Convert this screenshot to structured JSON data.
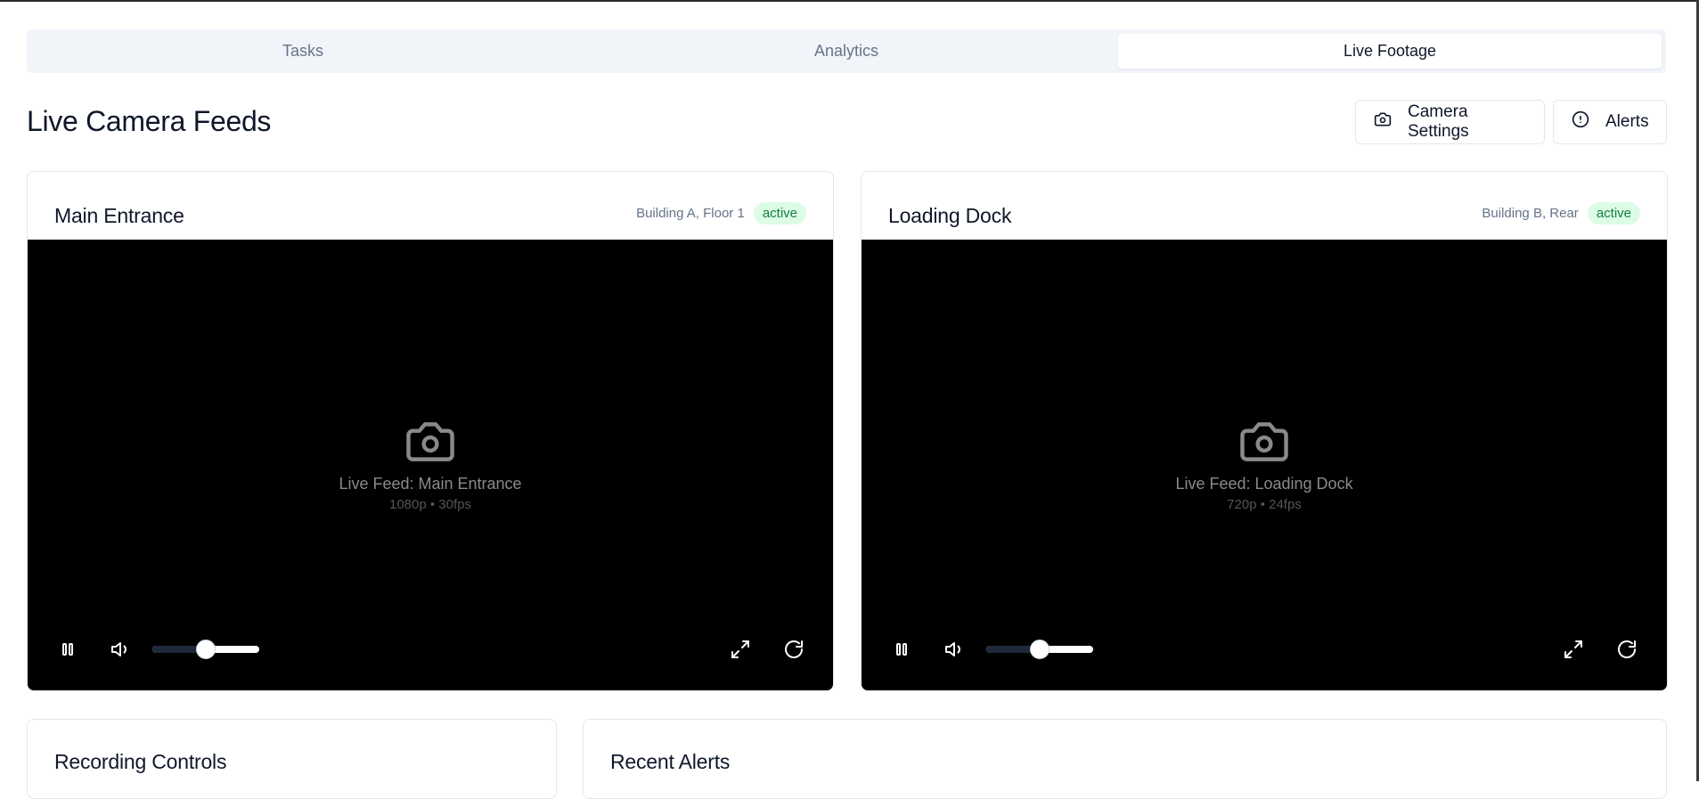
{
  "tabs": [
    {
      "label": "Tasks",
      "active": false
    },
    {
      "label": "Analytics",
      "active": false
    },
    {
      "label": "Live Footage",
      "active": true
    }
  ],
  "header": {
    "title": "Live Camera Feeds",
    "camera_settings_label": "Camera Settings",
    "alerts_label": "Alerts"
  },
  "cameras": [
    {
      "name": "Main Entrance",
      "location": "Building A, Floor 1",
      "status": "active",
      "feed_label": "Live Feed: Main Entrance",
      "feed_spec": "1080p • 30fps",
      "volume": 0.5
    },
    {
      "name": "Loading Dock",
      "location": "Building B, Rear",
      "status": "active",
      "feed_label": "Live Feed: Loading Dock",
      "feed_spec": "720p • 24fps",
      "volume": 0.5
    }
  ],
  "bottom": {
    "recording_controls_title": "Recording Controls",
    "recent_alerts_title": "Recent Alerts"
  },
  "colors": {
    "status_bg": "#dcfce7",
    "status_text": "#15803d",
    "video_bg": "#000000"
  }
}
